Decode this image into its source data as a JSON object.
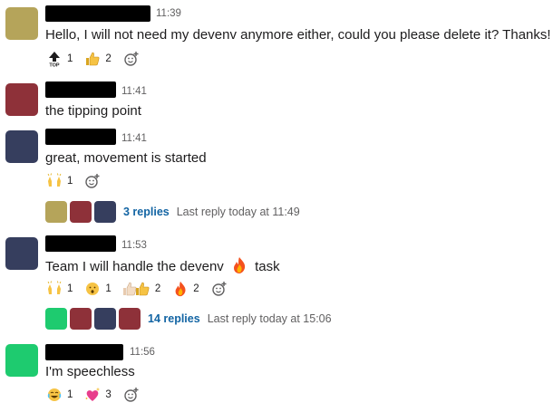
{
  "messages": [
    {
      "time": "11:39",
      "text": "Hello, I will not need my devenv anymore either, could you please delete it? Thanks!",
      "avatar_color": "#b5a45a",
      "reactions": [
        {
          "icon": "top-arrow",
          "count": "1"
        },
        {
          "icon": "thumbs-up",
          "count": "2"
        }
      ]
    },
    {
      "time": "11:41",
      "text": "the tipping point",
      "avatar_color": "#8e3139"
    },
    {
      "time": "11:41",
      "text": "great, movement is started",
      "avatar_color": "#363e5e",
      "reactions": [
        {
          "icon": "raised-hands",
          "count": "1"
        }
      ],
      "thread": {
        "avatars": [
          "#b5a45a",
          "#8e3139",
          "#363e5e"
        ],
        "replies": "3 replies",
        "last_reply": "Last reply today at 11:49"
      }
    },
    {
      "time": "11:53",
      "text_before": "Team I will handle the devenv",
      "text_after": "task",
      "inline_emoji": "fire",
      "avatar_color": "#363e5e",
      "reactions": [
        {
          "icon": "raised-hands",
          "count": "1"
        },
        {
          "icon": "hushed-face",
          "count": "1"
        },
        {
          "icon": "thumbs-up-skin-tones",
          "count": "2"
        },
        {
          "icon": "fire",
          "count": "2"
        }
      ],
      "thread": {
        "avatars": [
          "#1ecb6f",
          "#8e3139",
          "#363e5e",
          "#8e3139"
        ],
        "replies": "14 replies",
        "last_reply": "Last reply today at 15:06"
      }
    },
    {
      "time": "11:56",
      "text": "I'm speechless",
      "avatar_color": "#1ecb6f",
      "reactions": [
        {
          "icon": "joy-face",
          "count": "1"
        },
        {
          "icon": "sparkling-heart",
          "count": "3"
        }
      ]
    }
  ],
  "colors": {
    "link": "#1264a3",
    "muted": "#616061",
    "redacted": "#000000"
  }
}
